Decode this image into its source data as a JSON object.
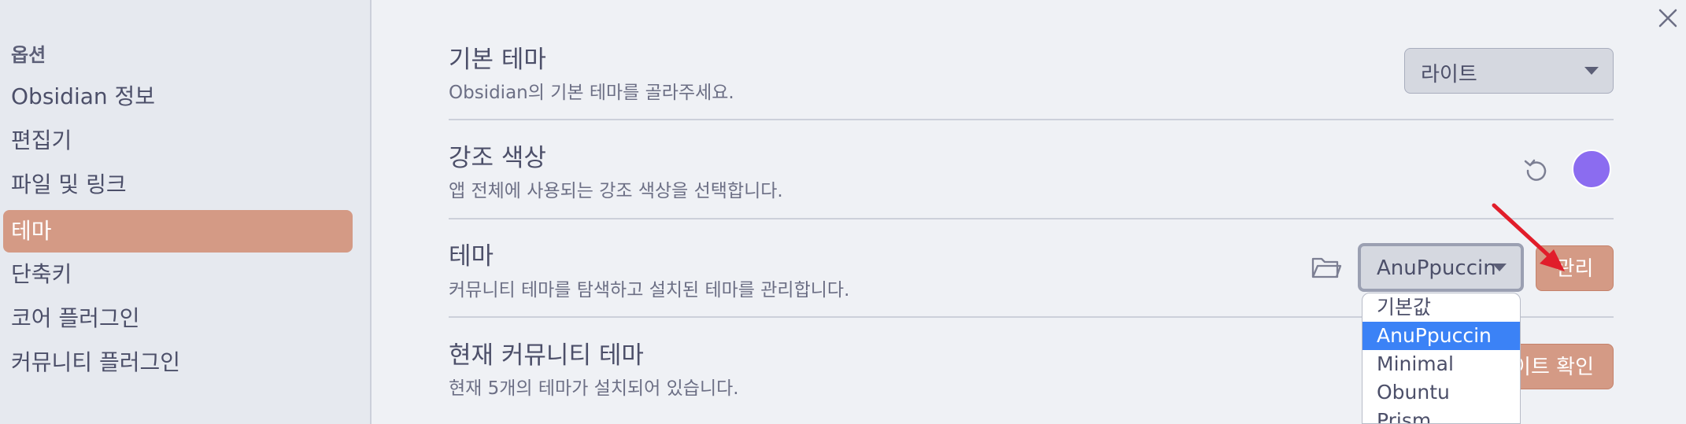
{
  "sidebar": {
    "heading": "옵션",
    "items": [
      {
        "label": "Obsidian 정보"
      },
      {
        "label": "편집기"
      },
      {
        "label": "파일 및 링크"
      },
      {
        "label": "테마"
      },
      {
        "label": "단축키"
      },
      {
        "label": "코어 플러그인"
      },
      {
        "label": "커뮤니티 플러그인"
      }
    ],
    "active_index": 3
  },
  "settings": {
    "base_theme": {
      "title": "기본 테마",
      "description": "Obsidian의 기본 테마를 골라주세요.",
      "selected": "라이트"
    },
    "accent_color": {
      "title": "강조 색상",
      "description": "앱 전체에 사용되는 강조 색상을 선택합니다.",
      "color": "#8b5cf6"
    },
    "theme": {
      "title": "테마",
      "description": "커뮤니티 테마를 탐색하고 설치된 테마를 관리합니다.",
      "selected": "AnuPpuccin",
      "manage_label": "관리",
      "options": [
        "기본값",
        "AnuPpuccin",
        "Minimal",
        "Obuntu",
        "Prism"
      ],
      "selected_option_index": 1
    },
    "current_community_theme": {
      "title": "현재 커뮤니티 테마",
      "description": "현재 5개의 테마가 설치되어 있습니다.",
      "button_label": "업데이트 확인",
      "button_visible_label": "이트 확인"
    }
  },
  "colors": {
    "accent": "#d49a85",
    "dropdown_highlight": "#3b82f6",
    "annotation_arrow": "#e11d2a"
  },
  "icons": [
    "close-icon",
    "reset-icon",
    "folder-icon",
    "chevron-down-icon",
    "arrow-annotation"
  ]
}
